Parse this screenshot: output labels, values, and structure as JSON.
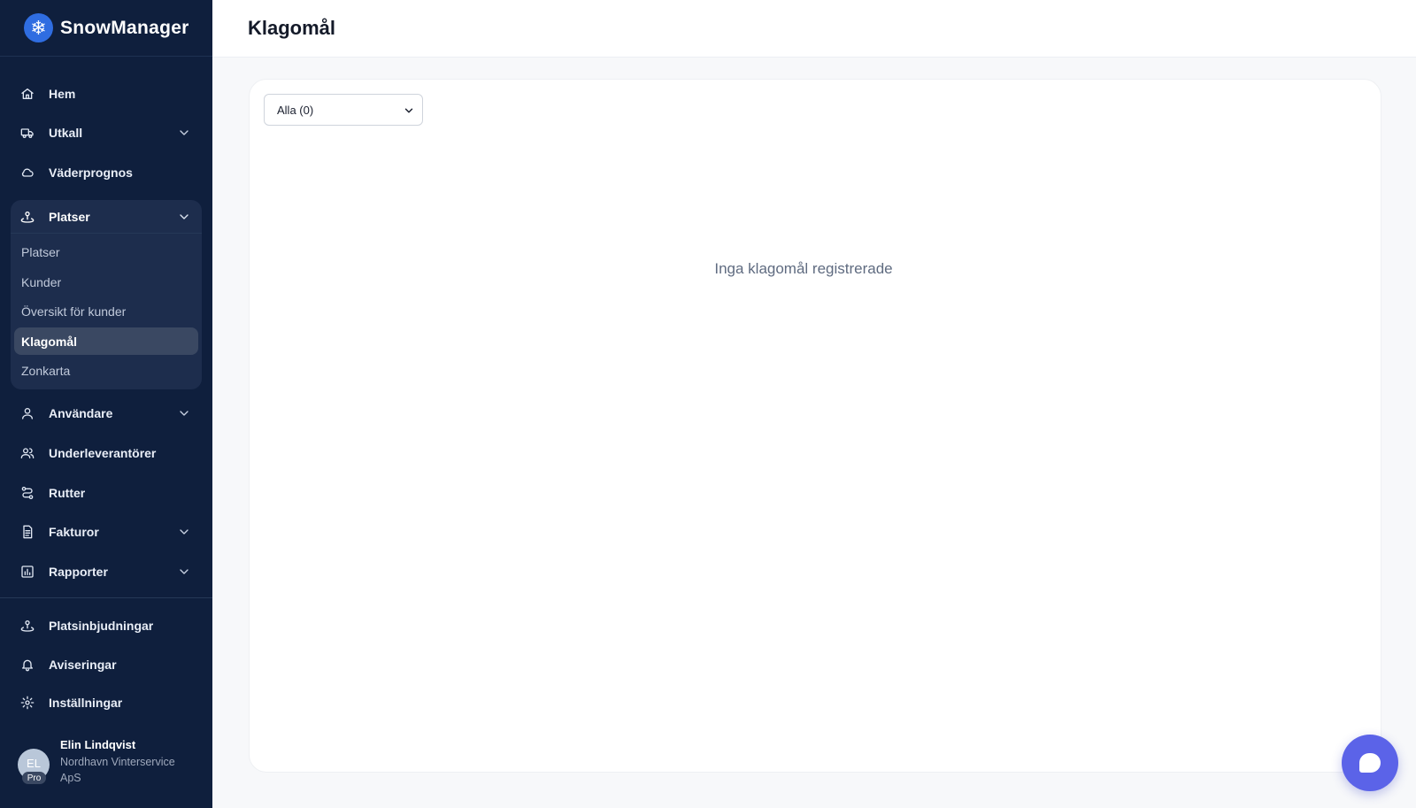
{
  "brand": {
    "name": "SnowManager"
  },
  "nav": {
    "items": [
      {
        "key": "hem",
        "label": "Hem",
        "icon": "home-icon",
        "chevron": false
      },
      {
        "key": "utkall",
        "label": "Utkall",
        "icon": "truck-icon",
        "chevron": true
      },
      {
        "key": "vaderprognos",
        "label": "Väderprognos",
        "icon": "cloud-icon",
        "chevron": false
      },
      {
        "key": "anvandare",
        "label": "Användare",
        "icon": "user-icon",
        "chevron": true
      },
      {
        "key": "underleverantorer",
        "label": "Underleverantörer",
        "icon": "users-icon",
        "chevron": false
      },
      {
        "key": "rutter",
        "label": "Rutter",
        "icon": "route-icon",
        "chevron": false
      },
      {
        "key": "fakturor",
        "label": "Fakturor",
        "icon": "invoice-icon",
        "chevron": true
      },
      {
        "key": "rapporter",
        "label": "Rapporter",
        "icon": "chart-icon",
        "chevron": true
      }
    ],
    "group": {
      "label": "Platser",
      "icon": "map-pin-icon",
      "items": [
        "Platser",
        "Kunder",
        "Översikt för kunder",
        "Klagomål",
        "Zonkarta"
      ],
      "active": "Klagomål"
    },
    "bottom_items": [
      {
        "key": "platsinbjudningar",
        "label": "Platsinbjudningar",
        "icon": "map-pin-icon"
      },
      {
        "key": "aviseringar",
        "label": "Aviseringar",
        "icon": "bell-icon"
      },
      {
        "key": "installningar",
        "label": "Inställningar",
        "icon": "gear-icon"
      }
    ]
  },
  "user": {
    "initials": "EL",
    "badge": "Pro",
    "name": "Elin Lindqvist",
    "org": "Nordhavn Vinterservice ApS"
  },
  "header": {
    "title": "Klagomål"
  },
  "filter": {
    "selected": "Alla (0)"
  },
  "empty_state": "Inga klagomål registrerade",
  "colors": {
    "sidebar": "#0f1f3d",
    "accent": "#5b63e8",
    "brand": "#2f6de1"
  }
}
